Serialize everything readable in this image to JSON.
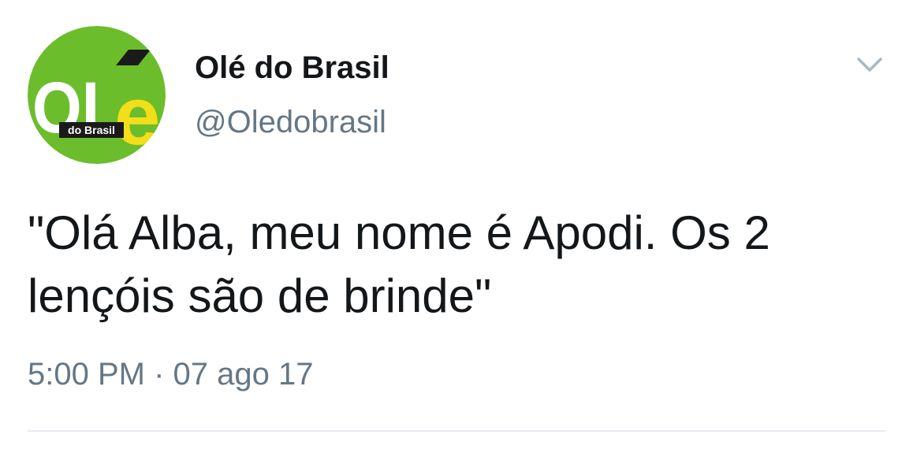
{
  "tweet": {
    "author": {
      "name": "Olé do Brasil",
      "handle": "@Oledobrasil",
      "avatar": {
        "logo_text": "OLé",
        "logo_subtext": "do Brasil",
        "colors": {
          "background": "#6cbd2b",
          "letters": "#ffffff",
          "accent_e": "#f2de19",
          "subtext_bg": "#1a1a1a"
        }
      }
    },
    "menu_icon": "chevron-down-icon",
    "text": "\"Olá Alba, meu nome é Apodi. Os 2 lençóis são de brinde\"",
    "timestamp": "5:00 PM · 07 ago 17",
    "colors": {
      "text": "#14171a",
      "secondary": "#657786",
      "divider": "#e6ecf0",
      "chevron": "#aab8c2"
    }
  }
}
